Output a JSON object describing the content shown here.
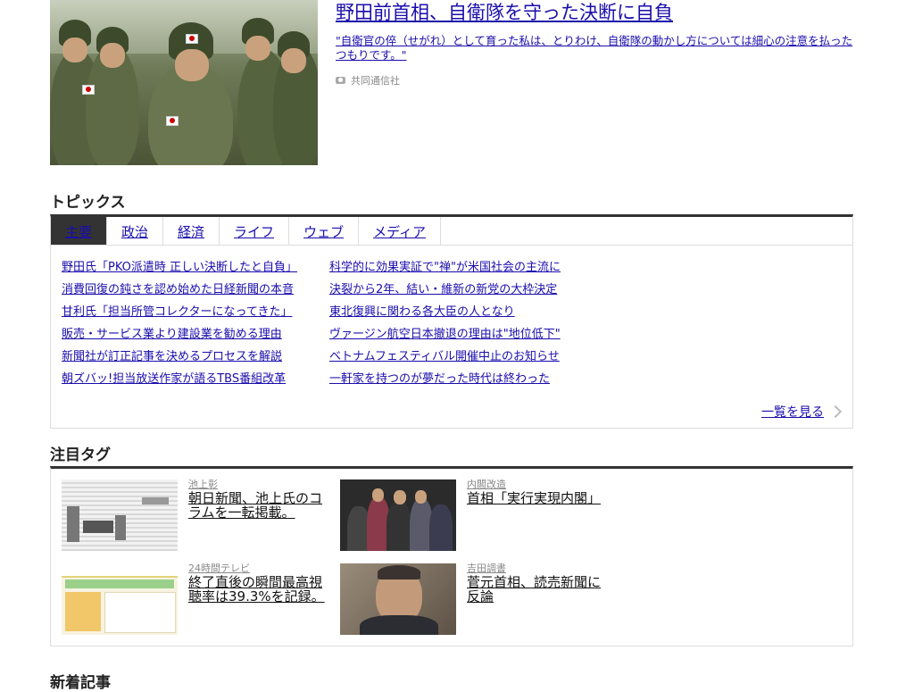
{
  "featured": {
    "title": "野田前首相、自衛隊を守った決断に自負",
    "description": "\"自衛官の倅（せがれ）として育った私は、とりわけ、自衛隊の動かし方については細心の注意を払ったつもりです。\"",
    "source": "共同通信社",
    "source_icon": "camera-icon"
  },
  "topics": {
    "title": "トピックス",
    "tabs": [
      {
        "label": "主要",
        "active": true
      },
      {
        "label": "政治",
        "active": false
      },
      {
        "label": "経済",
        "active": false
      },
      {
        "label": "ライフ",
        "active": false
      },
      {
        "label": "ウェブ",
        "active": false
      },
      {
        "label": "メディア",
        "active": false
      }
    ],
    "left_items": [
      "野田氏「PKO派遣時 正しい決断したと自負」",
      "消費回復の鈍さを認め始めた日経新聞の本音",
      "甘利氏「担当所管コレクターになってきた」",
      "販売・サービス業より建設業を勧める理由",
      "新聞社が訂正記事を決めるプロセスを解説",
      "朝ズバッ!担当放送作家が語るTBS番組改革"
    ],
    "right_items": [
      "科学的に効果実証で\"禅\"が米国社会の主流に",
      "決裂から2年、結い・維新の新党の大枠決定",
      "東北復興に関わる各大臣の人となり",
      "ヴァージン航空日本撤退の理由は\"地位低下\"",
      "ベトナムフェスティバル開催中止のお知らせ",
      "一軒家を持つのが夢だった時代は終わった"
    ],
    "see_all": "一覧を見る"
  },
  "tags": {
    "title": "注目タグ",
    "cards": [
      {
        "label": "池上彰",
        "headline": "朝日新聞、池上氏のコラムを一転掲載。"
      },
      {
        "label": "内閣改造",
        "headline": "首相「実行実現内閣」"
      },
      {
        "label": "24時間テレビ",
        "headline": "終了直後の瞬間最高視聴率は39.3%を記録。"
      },
      {
        "label": "吉田調書",
        "headline": "菅元首相、読売新聞に反論"
      }
    ]
  },
  "new_articles": {
    "title": "新着記事"
  }
}
